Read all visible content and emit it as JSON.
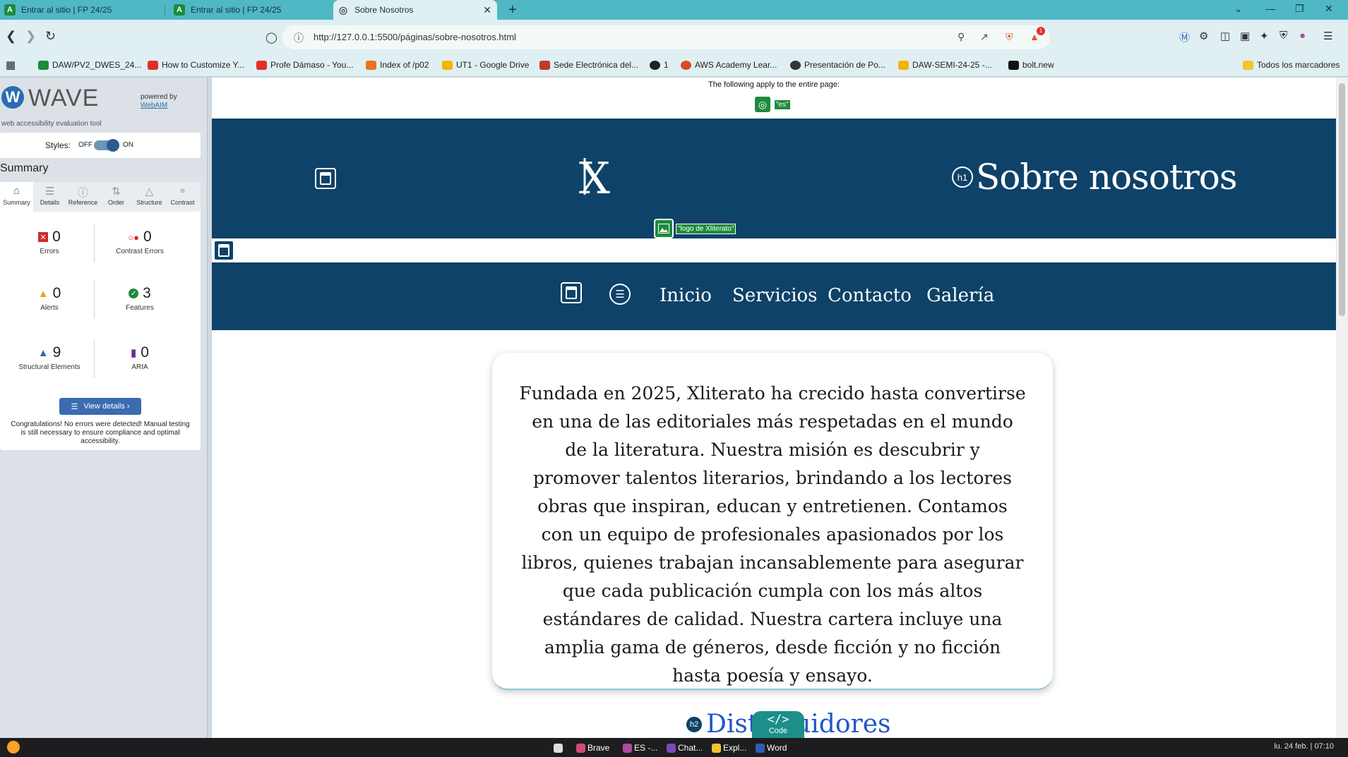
{
  "browser": {
    "tabs": [
      {
        "title": "Entrar al sitio | FP 24/25",
        "favicon": "A"
      },
      {
        "title": "Entrar al sitio | FP 24/25",
        "favicon": "A"
      },
      {
        "title": "Sobre Nosotros",
        "favicon": "globe"
      }
    ],
    "url": "http://127.0.0.1:5500/páginas/sobre-nosotros.html",
    "brave_badge": "1",
    "bookmarks": [
      {
        "label": "DAW/PV2_DWES_24...",
        "color": "#1d8a3e"
      },
      {
        "label": "How to Customize Y...",
        "color": "#e52d27"
      },
      {
        "label": "Profe Dámaso - You...",
        "color": "#e52d27"
      },
      {
        "label": "Index of /p02",
        "color": "#e8741f"
      },
      {
        "label": "UT1 - Google Drive",
        "color": "#f4b400"
      },
      {
        "label": "Sede Electrónica del...",
        "color": "#c0392b"
      },
      {
        "label": "1",
        "color": "#222222"
      },
      {
        "label": "AWS Academy Lear...",
        "color": "#d94c2a"
      },
      {
        "label": "Presentación de Po...",
        "color": "#333333"
      },
      {
        "label": "DAW-SEMI-24-25 -...",
        "color": "#f4b400"
      },
      {
        "label": "bolt.new",
        "color": "#111111"
      }
    ],
    "all_bookmarks": "Todos los marcadores"
  },
  "wave": {
    "logo_word": "WAVE",
    "tagline": "web accessibility evaluation tool",
    "powered_by": "powered by",
    "powered_link": "WebAIM",
    "styles_label": "Styles:",
    "styles_off": "OFF",
    "styles_on": "ON",
    "summary_title": "Summary",
    "tabs": [
      "Summary",
      "Details",
      "Reference",
      "Order",
      "Structure",
      "Contrast"
    ],
    "stats": {
      "errors": {
        "value": "0",
        "label": "Errors"
      },
      "contrast": {
        "value": "0",
        "label": "Contrast Errors"
      },
      "alerts": {
        "value": "0",
        "label": "Alerts"
      },
      "features": {
        "value": "3",
        "label": "Features"
      },
      "structural": {
        "value": "9",
        "label": "Structural Elements"
      },
      "aria": {
        "value": "0",
        "label": "ARIA"
      }
    },
    "view_details": "View details ›",
    "congrats": "Congratulations! No errors were detected! Manual testing is still necessary to ensure compliance and optimal accessibility."
  },
  "page": {
    "apply_note": "The following apply to the entire page:",
    "lang_tag": "\"es\"",
    "logo_text": "X",
    "logo_alt_tag": "\"logo de Xliterato\"",
    "h1_badge": "h1",
    "h1": "Sobre nosotros",
    "nav": [
      "Inicio",
      "Servicios",
      "Contacto",
      "Galería"
    ],
    "about": "Fundada en 2025, Xliterato ha crecido hasta convertirse en una de las editoriales más respetadas en el mundo de la literatura. Nuestra misión es descubrir y promover talentos literarios, brindando a los lectores obras que inspiran, educan y entretienen. Contamos con un equipo de profesionales apasionados por los libros, quienes trabajan incansablemente para asegurar que cada publicación cumpla con los más altos estándares de calidad. Nuestra cartera incluye una amplia gama de géneros, desde ficción y no ficción hasta poesía y ensayo.",
    "h2_badge": "h2",
    "h2": "Distribuidores",
    "code_badge": "Code"
  },
  "taskbar": {
    "items": [
      {
        "label": "",
        "color": "#dddddd"
      },
      {
        "label": "Brave",
        "color": "#d04a7a"
      },
      {
        "label": "ES -...",
        "color": "#b04aa0"
      },
      {
        "label": "Chat...",
        "color": "#7a4ac0"
      },
      {
        "label": "Expl...",
        "color": "#f4c430"
      },
      {
        "label": "Word",
        "color": "#2b5fb3"
      }
    ],
    "clock": "lu. 24 feb. | 07:10"
  },
  "colors": {
    "site_primary": "#0e4268",
    "wave_green": "#1d8a3e",
    "wave_blue": "#2b6cb3",
    "tab_bar": "#4fb8c4"
  }
}
